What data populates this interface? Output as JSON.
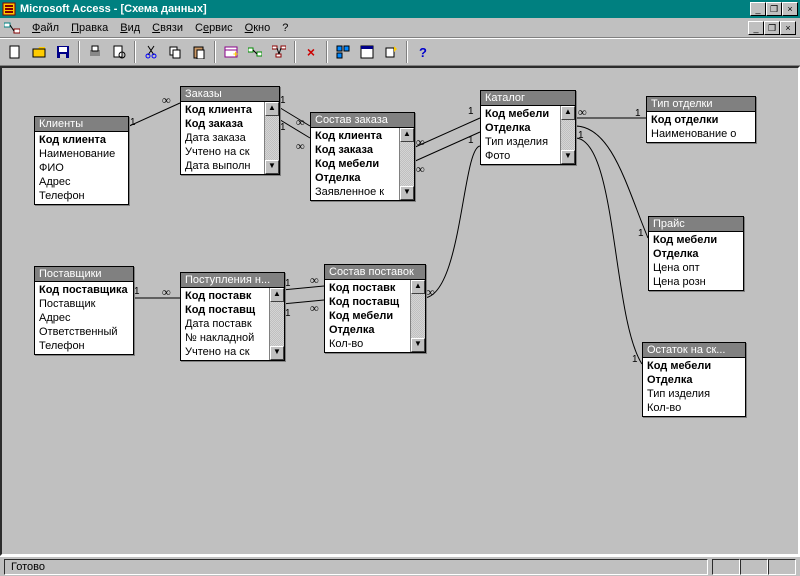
{
  "window": {
    "title": "Microsoft Access - [Схема данных]"
  },
  "menu": {
    "file": "Файл",
    "edit": "Правка",
    "view": "Вид",
    "relations": "Связи",
    "tools": "Сервис",
    "window": "Окно",
    "help": "?"
  },
  "status": {
    "text": "Готово"
  },
  "tables": {
    "clients": {
      "title": "Клиенты",
      "fields": [
        {
          "name": "Код клиента",
          "bold": true
        },
        {
          "name": "Наименование"
        },
        {
          "name": "ФИО"
        },
        {
          "name": "Адрес"
        },
        {
          "name": "Телефон"
        }
      ]
    },
    "orders": {
      "title": "Заказы",
      "fields": [
        {
          "name": "Код клиента",
          "bold": true
        },
        {
          "name": "Код заказа",
          "bold": true
        },
        {
          "name": "Дата заказа"
        },
        {
          "name": "Учтено на ск"
        },
        {
          "name": "Дата выполн"
        }
      ]
    },
    "order_content": {
      "title": "Состав заказа",
      "fields": [
        {
          "name": "Код клиента",
          "bold": true
        },
        {
          "name": "Код заказа",
          "bold": true
        },
        {
          "name": "Код мебели",
          "bold": true
        },
        {
          "name": "Отделка",
          "bold": true
        },
        {
          "name": "Заявленное к"
        }
      ]
    },
    "catalog": {
      "title": "Каталог",
      "fields": [
        {
          "name": "Код мебели",
          "bold": true
        },
        {
          "name": "Отделка",
          "bold": true
        },
        {
          "name": "Тип изделия"
        },
        {
          "name": "Фото"
        }
      ]
    },
    "finish_type": {
      "title": "Тип отделки",
      "fields": [
        {
          "name": "Код отделки",
          "bold": true
        },
        {
          "name": "Наименование о"
        }
      ]
    },
    "price": {
      "title": "Прайс",
      "fields": [
        {
          "name": "Код мебели",
          "bold": true
        },
        {
          "name": "Отделка",
          "bold": true
        },
        {
          "name": "Цена опт"
        },
        {
          "name": "Цена розн"
        }
      ]
    },
    "suppliers": {
      "title": "Поставщики",
      "fields": [
        {
          "name": "Код поставщика",
          "bold": true
        },
        {
          "name": "Поставщик"
        },
        {
          "name": "Адрес"
        },
        {
          "name": "Ответственный"
        },
        {
          "name": "Телефон"
        }
      ]
    },
    "shipments": {
      "title": "Поступления н...",
      "fields": [
        {
          "name": "Код поставк",
          "bold": true
        },
        {
          "name": "Код поставщ",
          "bold": true
        },
        {
          "name": "Дата поставк"
        },
        {
          "name": "№ накладной"
        },
        {
          "name": "Учтено на ск"
        }
      ]
    },
    "shipment_content": {
      "title": "Состав поставок",
      "fields": [
        {
          "name": "Код поставк",
          "bold": true
        },
        {
          "name": "Код поставщ",
          "bold": true
        },
        {
          "name": "Код мебели",
          "bold": true
        },
        {
          "name": "Отделка",
          "bold": true
        },
        {
          "name": "Кол-во"
        }
      ]
    },
    "stock": {
      "title": "Остаток на ск...",
      "fields": [
        {
          "name": "Код мебели",
          "bold": true
        },
        {
          "name": "Отделка",
          "bold": true
        },
        {
          "name": "Тип изделия"
        },
        {
          "name": "Кол-во"
        }
      ]
    }
  },
  "relationships": [
    {
      "from": "clients",
      "to": "orders",
      "card_from": "1",
      "card_to": "∞"
    },
    {
      "from": "orders",
      "to": "order_content",
      "card_from": "1",
      "card_to": "∞"
    },
    {
      "from": "order_content",
      "to": "catalog",
      "card_from": "∞",
      "card_to": "1"
    },
    {
      "from": "catalog",
      "to": "finish_type",
      "card_from": "∞",
      "card_to": "1"
    },
    {
      "from": "catalog",
      "to": "price",
      "card_from": "1",
      "card_to": "1"
    },
    {
      "from": "catalog",
      "to": "stock",
      "card_from": "1",
      "card_to": "1"
    },
    {
      "from": "suppliers",
      "to": "shipments",
      "card_from": "1",
      "card_to": "∞"
    },
    {
      "from": "shipments",
      "to": "shipment_content",
      "card_from": "1",
      "card_to": "∞"
    },
    {
      "from": "shipment_content",
      "to": "catalog",
      "card_from": "∞",
      "card_to": "1"
    }
  ]
}
